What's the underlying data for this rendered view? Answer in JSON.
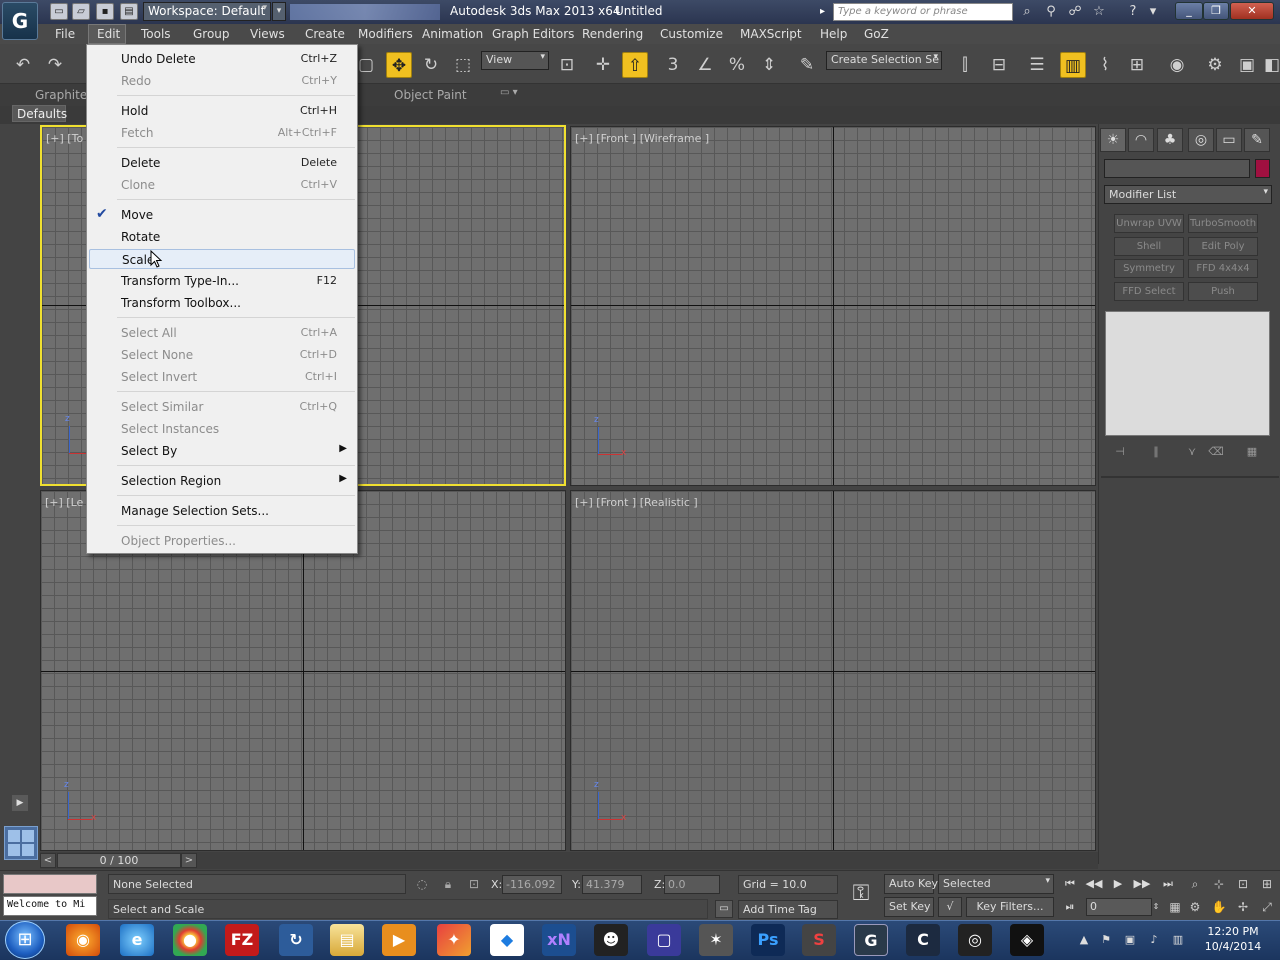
{
  "titlebar": {
    "app_logo": "G",
    "workspace": "Workspace: Default",
    "title": "Autodesk 3ds Max 2013 x64",
    "document": "Untitled",
    "search_placeholder": "Type a keyword or phrase"
  },
  "menubar": {
    "items": [
      "File",
      "Edit",
      "Tools",
      "Group",
      "Views",
      "Create",
      "Modifiers",
      "Animation",
      "Graph Editors",
      "Rendering",
      "Customize",
      "MAXScript",
      "Help",
      "GoZ"
    ]
  },
  "toolbar": {
    "ref_coord": "View",
    "selection_set_placeholder": "Create Selection Se"
  },
  "ribbon": {
    "tabs": [
      "Graphite",
      "Object Paint"
    ],
    "defaults": "Defaults"
  },
  "viewports": {
    "top": "[+] [To",
    "front_wireframe": "[+] [Front ] [Wireframe ]",
    "left": "[+] [Le",
    "front_realistic": "[+] [Front ] [Realistic ]",
    "axis_z": "z",
    "axis_x": "x"
  },
  "edit_menu": {
    "items": [
      {
        "label": "Undo Delete",
        "shortcut": "Ctrl+Z"
      },
      {
        "label": "Redo",
        "shortcut": "Ctrl+Y"
      },
      {
        "label": "Hold",
        "shortcut": "Ctrl+H"
      },
      {
        "label": "Fetch",
        "shortcut": "Alt+Ctrl+F"
      },
      {
        "label": "Delete",
        "shortcut": "Delete"
      },
      {
        "label": "Clone",
        "shortcut": "Ctrl+V"
      },
      {
        "label": "Move",
        "shortcut": ""
      },
      {
        "label": "Rotate",
        "shortcut": ""
      },
      {
        "label": "Scale",
        "shortcut": ""
      },
      {
        "label": "Transform Type-In...",
        "shortcut": "F12"
      },
      {
        "label": "Transform Toolbox...",
        "shortcut": ""
      },
      {
        "label": "Select All",
        "shortcut": "Ctrl+A"
      },
      {
        "label": "Select None",
        "shortcut": "Ctrl+D"
      },
      {
        "label": "Select Invert",
        "shortcut": "Ctrl+I"
      },
      {
        "label": "Select Similar",
        "shortcut": "Ctrl+Q"
      },
      {
        "label": "Select Instances",
        "shortcut": ""
      },
      {
        "label": "Select By",
        "shortcut": ""
      },
      {
        "label": "Selection Region",
        "shortcut": ""
      },
      {
        "label": "Manage Selection Sets...",
        "shortcut": ""
      },
      {
        "label": "Object Properties...",
        "shortcut": ""
      }
    ]
  },
  "command_panel": {
    "modifier_list": "Modifier List",
    "modifiers": [
      "Unwrap UVW",
      "TurboSmooth",
      "Shell",
      "Edit Poly",
      "Symmetry",
      "FFD 4x4x4",
      "FFD Select",
      "Push"
    ],
    "object_color": "#a01040"
  },
  "timeslider": {
    "frame": "0 / 100",
    "prev": "<",
    "next": ">"
  },
  "status": {
    "selection": "None Selected",
    "prompt": "Select and Scale",
    "listener": "Welcome to Mi",
    "x_label": "X:",
    "x_value": "-116.092",
    "y_label": "Y:",
    "y_value": "41.379",
    "z_label": "Z:",
    "z_value": "0.0",
    "grid": "Grid = 10.0",
    "add_time_tag": "Add Time Tag",
    "auto_key": "Auto Key",
    "set_key": "Set Key",
    "key_mode": "Selected",
    "key_filters": "Key Filters...",
    "current_frame": "0"
  },
  "taskbar": {
    "time": "12:20 PM",
    "date": "10/4/2014",
    "apps": [
      "firefox",
      "ie",
      "chrome",
      "filezilla",
      "sync",
      "explorer",
      "media",
      "photo",
      "dropbox",
      "xn",
      "mudbox",
      "app",
      "zbrush",
      "photoshop",
      "substance",
      "3dsmax",
      "c4d",
      "blender",
      "unity"
    ]
  }
}
